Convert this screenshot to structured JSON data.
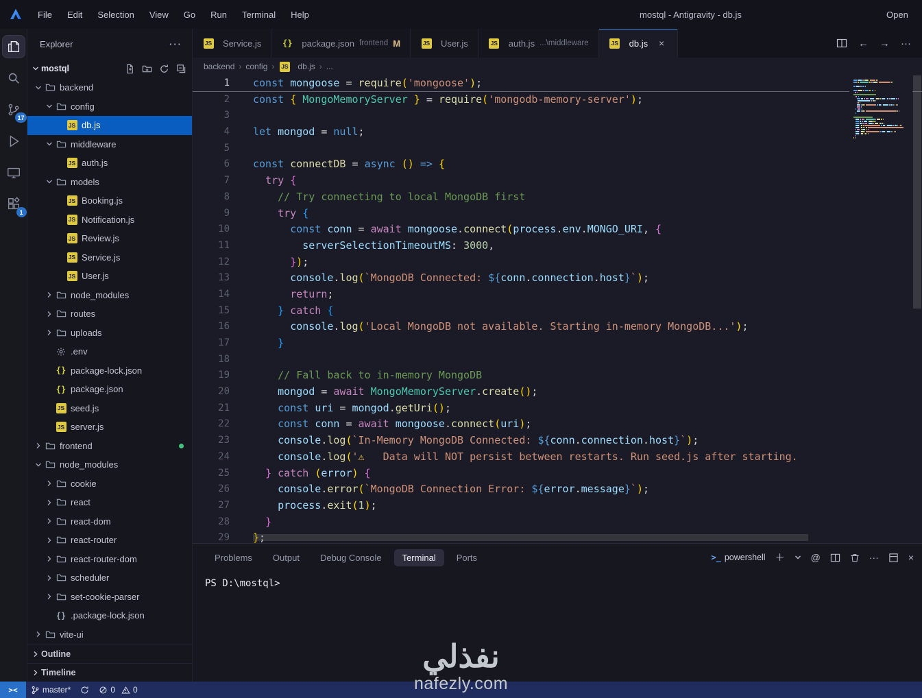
{
  "titlebar": {
    "menus": [
      "File",
      "Edit",
      "Selection",
      "View",
      "Go",
      "Run",
      "Terminal",
      "Help"
    ],
    "window_title": "mostql - Antigravity - db.js",
    "right_text": "Open"
  },
  "activity_bar": {
    "items": [
      {
        "id": "explorer",
        "active": true
      },
      {
        "id": "search"
      },
      {
        "id": "source-control",
        "badge": "17"
      },
      {
        "id": "run-debug"
      },
      {
        "id": "remote-explorer"
      },
      {
        "id": "extensions",
        "badge": "1"
      }
    ]
  },
  "sidebar": {
    "header_title": "Explorer",
    "header_more": "···",
    "workspace_label": "mostql",
    "tree": [
      {
        "label": "backend",
        "type": "folder",
        "depth": 1,
        "state": "expanded"
      },
      {
        "label": "config",
        "type": "folder",
        "depth": 2,
        "state": "expanded"
      },
      {
        "label": "db.js",
        "type": "js",
        "depth": 3,
        "selected": true
      },
      {
        "label": "middleware",
        "type": "folder",
        "depth": 2,
        "state": "expanded"
      },
      {
        "label": "auth.js",
        "type": "js",
        "depth": 3
      },
      {
        "label": "models",
        "type": "folder",
        "depth": 2,
        "state": "expanded"
      },
      {
        "label": "Booking.js",
        "type": "js",
        "depth": 3
      },
      {
        "label": "Notification.js",
        "type": "js",
        "depth": 3
      },
      {
        "label": "Review.js",
        "type": "js",
        "depth": 3
      },
      {
        "label": "Service.js",
        "type": "js",
        "depth": 3
      },
      {
        "label": "User.js",
        "type": "js",
        "depth": 3
      },
      {
        "label": "node_modules",
        "type": "folder",
        "depth": 2,
        "state": "collapsed"
      },
      {
        "label": "routes",
        "type": "folder",
        "depth": 2,
        "state": "collapsed"
      },
      {
        "label": "uploads",
        "type": "folder",
        "depth": 2,
        "state": "collapsed"
      },
      {
        "label": ".env",
        "type": "gear",
        "depth": 2
      },
      {
        "label": "package-lock.json",
        "type": "json",
        "depth": 2
      },
      {
        "label": "package.json",
        "type": "json",
        "depth": 2
      },
      {
        "label": "seed.js",
        "type": "js",
        "depth": 2
      },
      {
        "label": "server.js",
        "type": "js",
        "depth": 2
      },
      {
        "label": "frontend",
        "type": "folder",
        "depth": 1,
        "state": "collapsed",
        "dot": true
      },
      {
        "label": "node_modules",
        "type": "folder",
        "depth": 1,
        "state": "expanded"
      },
      {
        "label": "cookie",
        "type": "folder",
        "depth": 2,
        "state": "collapsed"
      },
      {
        "label": "react",
        "type": "folder",
        "depth": 2,
        "state": "collapsed"
      },
      {
        "label": "react-dom",
        "type": "folder",
        "depth": 2,
        "state": "collapsed"
      },
      {
        "label": "react-router",
        "type": "folder",
        "depth": 2,
        "state": "collapsed"
      },
      {
        "label": "react-router-dom",
        "type": "folder",
        "depth": 2,
        "state": "collapsed"
      },
      {
        "label": "scheduler",
        "type": "folder",
        "depth": 2,
        "state": "collapsed"
      },
      {
        "label": "set-cookie-parser",
        "type": "folder",
        "depth": 2,
        "state": "collapsed"
      },
      {
        "label": ".package-lock.json",
        "type": "braces",
        "depth": 2
      },
      {
        "label": "vite-ui",
        "type": "folder",
        "depth": 1,
        "state": "collapsed"
      }
    ],
    "bottom_sections": [
      "Outline",
      "Timeline"
    ]
  },
  "editor": {
    "tabs": [
      {
        "label": "Service.js",
        "icon": "js"
      },
      {
        "label": "package.json",
        "icon": "json",
        "description": "frontend",
        "modified_badge": "M"
      },
      {
        "label": "User.js",
        "icon": "js"
      },
      {
        "label": "auth.js",
        "icon": "js",
        "description": "...\\middleware"
      },
      {
        "label": "db.js",
        "icon": "js",
        "active": true,
        "close": "×"
      }
    ],
    "breadcrumb": [
      {
        "label": "backend"
      },
      {
        "label": "config"
      },
      {
        "label": "db.js",
        "icon": "js"
      },
      {
        "label": "..."
      }
    ],
    "code_lines": [
      [
        [
          "k",
          "const "
        ],
        [
          "v",
          "mongoose"
        ],
        [
          "p",
          " = "
        ],
        [
          "f",
          "require"
        ],
        [
          "b1",
          "("
        ],
        [
          "s",
          "'mongoose'"
        ],
        [
          "b1",
          ")"
        ],
        [
          "p",
          ";"
        ]
      ],
      [
        [
          "k",
          "const "
        ],
        [
          "b1",
          "{ "
        ],
        [
          "t",
          "MongoMemoryServer"
        ],
        [
          "b1",
          " }"
        ],
        [
          "p",
          " = "
        ],
        [
          "f",
          "require"
        ],
        [
          "b1",
          "("
        ],
        [
          "s",
          "'mongodb-memory-server'"
        ],
        [
          "b1",
          ")"
        ],
        [
          "p",
          ";"
        ]
      ],
      [],
      [
        [
          "k",
          "let "
        ],
        [
          "v",
          "mongod"
        ],
        [
          "p",
          " = "
        ],
        [
          "k",
          "null"
        ],
        [
          "p",
          ";"
        ]
      ],
      [],
      [
        [
          "k",
          "const "
        ],
        [
          "f",
          "connectDB"
        ],
        [
          "p",
          " = "
        ],
        [
          "k",
          "async "
        ],
        [
          "b1",
          "()"
        ],
        [
          "p",
          " "
        ],
        [
          "k",
          "=>"
        ],
        [
          "p",
          " "
        ],
        [
          "b1",
          "{"
        ]
      ],
      [
        [
          "p",
          "  "
        ],
        [
          "c",
          "try"
        ],
        [
          "p",
          " "
        ],
        [
          "b2",
          "{"
        ]
      ],
      [
        [
          "m",
          "    // Try connecting to local MongoDB first"
        ]
      ],
      [
        [
          "p",
          "    "
        ],
        [
          "c",
          "try"
        ],
        [
          "p",
          " "
        ],
        [
          "b3",
          "{"
        ]
      ],
      [
        [
          "p",
          "      "
        ],
        [
          "k",
          "const "
        ],
        [
          "v",
          "conn"
        ],
        [
          "p",
          " = "
        ],
        [
          "c",
          "await"
        ],
        [
          "p",
          " "
        ],
        [
          "v",
          "mongoose"
        ],
        [
          "p",
          "."
        ],
        [
          "f",
          "connect"
        ],
        [
          "b1",
          "("
        ],
        [
          "v",
          "process"
        ],
        [
          "p",
          "."
        ],
        [
          "v",
          "env"
        ],
        [
          "p",
          "."
        ],
        [
          "v",
          "MONGO_URI"
        ],
        [
          "p",
          ", "
        ],
        [
          "b2",
          "{"
        ]
      ],
      [
        [
          "p",
          "        "
        ],
        [
          "v",
          "serverSelectionTimeoutMS"
        ],
        [
          "p",
          ": "
        ],
        [
          "n",
          "3000"
        ],
        [
          "p",
          ","
        ]
      ],
      [
        [
          "p",
          "      "
        ],
        [
          "b2",
          "}"
        ],
        [
          "b1",
          ")"
        ],
        [
          "p",
          ";"
        ]
      ],
      [
        [
          "p",
          "      "
        ],
        [
          "v",
          "console"
        ],
        [
          "p",
          "."
        ],
        [
          "f",
          "log"
        ],
        [
          "b1",
          "("
        ],
        [
          "s",
          "`MongoDB Connected: "
        ],
        [
          "k",
          "${"
        ],
        [
          "v",
          "conn"
        ],
        [
          "p",
          "."
        ],
        [
          "v",
          "connection"
        ],
        [
          "p",
          "."
        ],
        [
          "v",
          "host"
        ],
        [
          "k",
          "}"
        ],
        [
          "s",
          "`"
        ],
        [
          "b1",
          ")"
        ],
        [
          "p",
          ";"
        ]
      ],
      [
        [
          "p",
          "      "
        ],
        [
          "c",
          "return"
        ],
        [
          "p",
          ";"
        ]
      ],
      [
        [
          "p",
          "    "
        ],
        [
          "b3",
          "}"
        ],
        [
          "p",
          " "
        ],
        [
          "c",
          "catch"
        ],
        [
          "p",
          " "
        ],
        [
          "b3",
          "{"
        ]
      ],
      [
        [
          "p",
          "      "
        ],
        [
          "v",
          "console"
        ],
        [
          "p",
          "."
        ],
        [
          "f",
          "log"
        ],
        [
          "b1",
          "("
        ],
        [
          "s",
          "'Local MongoDB not available. Starting in-memory MongoDB...'"
        ],
        [
          "b1",
          ")"
        ],
        [
          "p",
          ";"
        ]
      ],
      [
        [
          "p",
          "    "
        ],
        [
          "b3",
          "}"
        ]
      ],
      [],
      [
        [
          "m",
          "    // Fall back to in-memory MongoDB"
        ]
      ],
      [
        [
          "p",
          "    "
        ],
        [
          "v",
          "mongod"
        ],
        [
          "p",
          " = "
        ],
        [
          "c",
          "await"
        ],
        [
          "p",
          " "
        ],
        [
          "t",
          "MongoMemoryServer"
        ],
        [
          "p",
          "."
        ],
        [
          "f",
          "create"
        ],
        [
          "b1",
          "()"
        ],
        [
          "p",
          ";"
        ]
      ],
      [
        [
          "p",
          "    "
        ],
        [
          "k",
          "const "
        ],
        [
          "v",
          "uri"
        ],
        [
          "p",
          " = "
        ],
        [
          "v",
          "mongod"
        ],
        [
          "p",
          "."
        ],
        [
          "f",
          "getUri"
        ],
        [
          "b1",
          "()"
        ],
        [
          "p",
          ";"
        ]
      ],
      [
        [
          "p",
          "    "
        ],
        [
          "k",
          "const "
        ],
        [
          "v",
          "conn"
        ],
        [
          "p",
          " = "
        ],
        [
          "c",
          "await"
        ],
        [
          "p",
          " "
        ],
        [
          "v",
          "mongoose"
        ],
        [
          "p",
          "."
        ],
        [
          "f",
          "connect"
        ],
        [
          "b1",
          "("
        ],
        [
          "v",
          "uri"
        ],
        [
          "b1",
          ")"
        ],
        [
          "p",
          ";"
        ]
      ],
      [
        [
          "p",
          "    "
        ],
        [
          "v",
          "console"
        ],
        [
          "p",
          "."
        ],
        [
          "f",
          "log"
        ],
        [
          "b1",
          "("
        ],
        [
          "s",
          "`In-Memory MongoDB Connected: "
        ],
        [
          "k",
          "${"
        ],
        [
          "v",
          "conn"
        ],
        [
          "p",
          "."
        ],
        [
          "v",
          "connection"
        ],
        [
          "p",
          "."
        ],
        [
          "v",
          "host"
        ],
        [
          "k",
          "}"
        ],
        [
          "s",
          "`"
        ],
        [
          "b1",
          ")"
        ],
        [
          "p",
          ";"
        ]
      ],
      [
        [
          "p",
          "    "
        ],
        [
          "v",
          "console"
        ],
        [
          "p",
          "."
        ],
        [
          "f",
          "log"
        ],
        [
          "b1",
          "("
        ],
        [
          "s",
          "'"
        ],
        [
          "w",
          "⚠ "
        ],
        [
          "s",
          "  Data will NOT persist between restarts. Run seed.js after starting."
        ]
      ],
      [
        [
          "p",
          "  "
        ],
        [
          "b2",
          "}"
        ],
        [
          "p",
          " "
        ],
        [
          "c",
          "catch"
        ],
        [
          "p",
          " "
        ],
        [
          "b1",
          "("
        ],
        [
          "v",
          "error"
        ],
        [
          "b1",
          ")"
        ],
        [
          "p",
          " "
        ],
        [
          "b2",
          "{"
        ]
      ],
      [
        [
          "p",
          "    "
        ],
        [
          "v",
          "console"
        ],
        [
          "p",
          "."
        ],
        [
          "f",
          "error"
        ],
        [
          "b1",
          "("
        ],
        [
          "s",
          "`MongoDB Connection Error: "
        ],
        [
          "k",
          "${"
        ],
        [
          "v",
          "error"
        ],
        [
          "p",
          "."
        ],
        [
          "v",
          "message"
        ],
        [
          "k",
          "}"
        ],
        [
          "s",
          "`"
        ],
        [
          "b1",
          ")"
        ],
        [
          "p",
          ";"
        ]
      ],
      [
        [
          "p",
          "    "
        ],
        [
          "v",
          "process"
        ],
        [
          "p",
          "."
        ],
        [
          "f",
          "exit"
        ],
        [
          "b1",
          "("
        ],
        [
          "n",
          "1"
        ],
        [
          "b1",
          ")"
        ],
        [
          "p",
          ";"
        ]
      ],
      [
        [
          "p",
          "  "
        ],
        [
          "b2",
          "}"
        ]
      ],
      [
        [
          "b1",
          "}"
        ],
        [
          "p",
          ";"
        ]
      ]
    ]
  },
  "panel": {
    "tabs": [
      {
        "label": "Problems"
      },
      {
        "label": "Output"
      },
      {
        "label": "Debug Console"
      },
      {
        "label": "Terminal",
        "active": true
      },
      {
        "label": "Ports"
      }
    ],
    "shell_label": "powershell",
    "terminal_prompt": "PS D:\\mostql>"
  },
  "statusbar": {
    "remote_glyph": "><",
    "branch": "master*",
    "errors": "0",
    "warnings": "0"
  },
  "watermark": {
    "arabic": "نفذلي",
    "domain": "nafezly.com"
  }
}
